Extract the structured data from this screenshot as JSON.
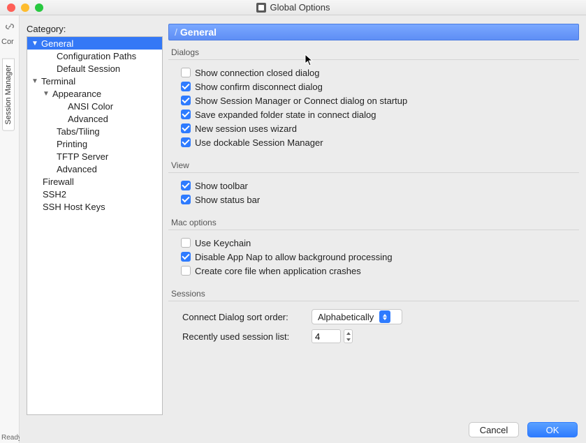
{
  "window": {
    "title": "Global Options"
  },
  "left_sidebar": {
    "cor": "Cor",
    "session_manager_tab": "Session Manager",
    "ready": "Ready"
  },
  "category_label": "Category:",
  "tree": {
    "general": "General",
    "config_paths": "Configuration Paths",
    "default_session": "Default Session",
    "terminal": "Terminal",
    "appearance": "Appearance",
    "ansi_color": "ANSI Color",
    "advanced_appearance": "Advanced",
    "tabs_tiling": "Tabs/Tiling",
    "printing": "Printing",
    "tftp_server": "TFTP Server",
    "advanced_terminal": "Advanced",
    "firewall": "Firewall",
    "ssh2": "SSH2",
    "ssh_host_keys": "SSH Host Keys"
  },
  "pane": {
    "title": "General",
    "sections": {
      "dialogs": "Dialogs",
      "view": "View",
      "mac_options": "Mac options",
      "sessions": "Sessions"
    },
    "dialogs": {
      "show_conn_closed": "Show connection closed dialog",
      "show_confirm_disconnect": "Show confirm disconnect dialog",
      "show_session_mgr_on_startup": "Show Session Manager or Connect dialog on startup",
      "save_expanded_folder": "Save expanded folder state in connect dialog",
      "new_session_wizard": "New session uses wizard",
      "use_dockable_sm": "Use dockable Session Manager"
    },
    "view": {
      "show_toolbar": "Show toolbar",
      "show_status_bar": "Show status bar"
    },
    "mac": {
      "use_keychain": "Use Keychain",
      "disable_app_nap": "Disable App Nap to allow background processing",
      "create_core_file": "Create core file when application crashes"
    },
    "sessions_form": {
      "sort_order_label": "Connect Dialog sort order:",
      "sort_order_value": "Alphabetically",
      "recently_used_label": "Recently used session list:",
      "recently_used_value": "4"
    }
  },
  "footer": {
    "cancel": "Cancel",
    "ok": "OK"
  }
}
